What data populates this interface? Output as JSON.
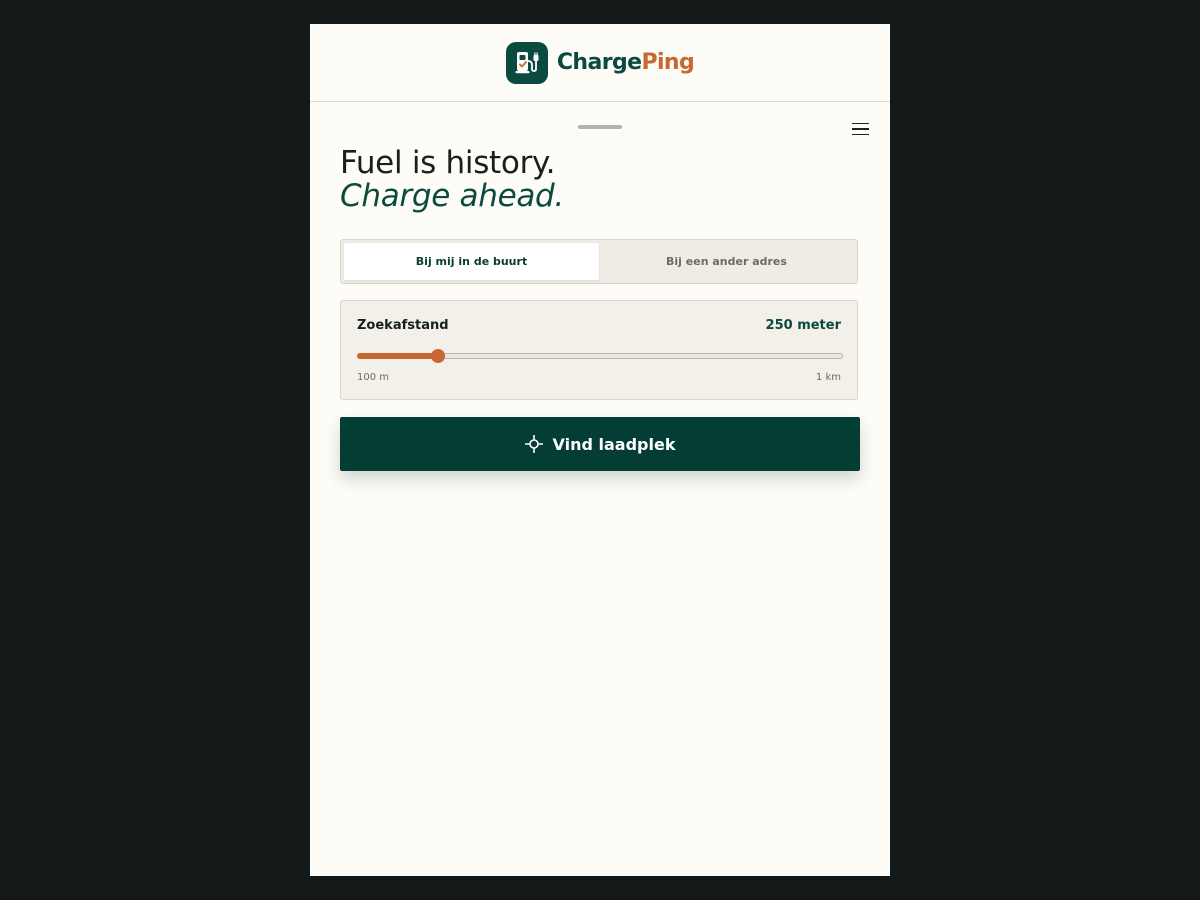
{
  "brand": {
    "name_part1": "Charge",
    "name_part2": "Ping",
    "primary_color": "#0b4a3e",
    "accent_color": "#c8672f",
    "logo_icon": "charging-station-icon"
  },
  "menu": {
    "icon": "hamburger-menu-icon"
  },
  "hero": {
    "line1": "Fuel is history.",
    "line2": "Charge ahead."
  },
  "location_tabs": {
    "items": [
      {
        "label": "Bij mij in de buurt",
        "active": true
      },
      {
        "label": "Bij een ander adres",
        "active": false
      }
    ]
  },
  "search_distance": {
    "label": "Zoekafstand",
    "value_text": "250 meter",
    "min_label": "100 m",
    "max_label": "1 km",
    "min_meters": 100,
    "max_meters": 1000,
    "value_meters": 250
  },
  "cta": {
    "label": "Vind laadplek",
    "icon": "crosshair-locate-icon"
  }
}
